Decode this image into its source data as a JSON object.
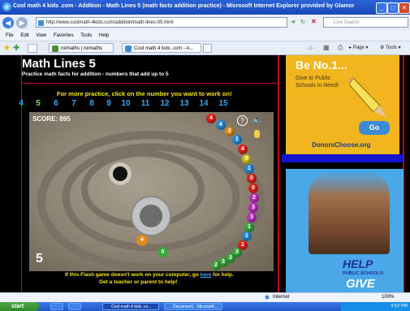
{
  "window": {
    "title": "Cool math 4 kids .com - Addition - Math Lines 5 (math facts addition practice) - Microsoft Internet Explorer provided by Glamor"
  },
  "address": {
    "url": "http://www.coolmath-4kids.com/addition/math-lines-05.html",
    "search_placeholder": "Live Search"
  },
  "menu": [
    "File",
    "Edit",
    "View",
    "Favorites",
    "Tools",
    "Help"
  ],
  "tabs": [
    {
      "label": "roimaths | roimaths"
    },
    {
      "label": "Cool math 4 kids .com - A..."
    }
  ],
  "toolbar": {
    "page_label": "Page",
    "tools_label": "Tools"
  },
  "game": {
    "title": "Math Lines 5",
    "subtitle": "Practice math facts for addition - numbers that add up to 5",
    "practice_prompt": "For more practice, click on the number you want to work on!",
    "numbers": [
      "4",
      "5",
      "6",
      "7",
      "8",
      "9",
      "10",
      "11",
      "12",
      "13",
      "14",
      "15"
    ],
    "selected_number": "5",
    "score_label": "SCORE: 895",
    "level": "5",
    "shooter_ball": "4",
    "next_ball": "0",
    "footer_line1_pre": "If this Flash game doesn't work on your computer, go ",
    "footer_link": "here",
    "footer_line1_post": " for help.",
    "footer_line2": "Get a teacher or parent to help!"
  },
  "balls": [
    {
      "label": "4",
      "color": "#e0241c"
    },
    {
      "label": "4",
      "color": "#2a8ad8"
    },
    {
      "label": "2",
      "color": "#e08a1c"
    },
    {
      "label": "1",
      "color": "#2a8ad8"
    },
    {
      "label": "4",
      "color": "#e0241c"
    },
    {
      "label": "0",
      "color": "#d0c020"
    },
    {
      "label": "1",
      "color": "#2a8ad8"
    },
    {
      "label": "0",
      "color": "#e0241c"
    },
    {
      "label": "0",
      "color": "#e0241c"
    },
    {
      "label": "2",
      "color": "#c02cc0"
    },
    {
      "label": "3",
      "color": "#c02cc0"
    },
    {
      "label": "3",
      "color": "#c02cc0"
    },
    {
      "label": "1",
      "color": "#3aa83a"
    },
    {
      "label": "1",
      "color": "#2a8ad8"
    },
    {
      "label": "1",
      "color": "#e0241c"
    },
    {
      "label": "3",
      "color": "#3aa83a"
    },
    {
      "label": "3",
      "color": "#3aa83a"
    },
    {
      "label": "3",
      "color": "#3aa83a"
    },
    {
      "label": "2",
      "color": "#3aa83a"
    }
  ],
  "ads": {
    "ad1_heading": "Be No.1...",
    "ad1_text": "Give to Public Schools in Need!",
    "ad1_go": "Go",
    "ad1_brand": "DonorsChoose.org",
    "ad2_help": "HELP",
    "ad2_public": "PUBLIC SCHOOLS!",
    "ad2_give": "GIVE"
  },
  "status": {
    "zone": "Internet",
    "zoom": "100%"
  },
  "taskbar": {
    "start": "start",
    "items": [
      "",
      "",
      "Cool math 4 kids .co...",
      "Document1 - Microsoft..."
    ],
    "clock": "4:52 PM"
  },
  "colors": {
    "brand_red": "#c8001a",
    "number_blue": "#33a6f0",
    "selected_green": "#7fe04a",
    "prompt_yellow": "#f5e50a"
  }
}
